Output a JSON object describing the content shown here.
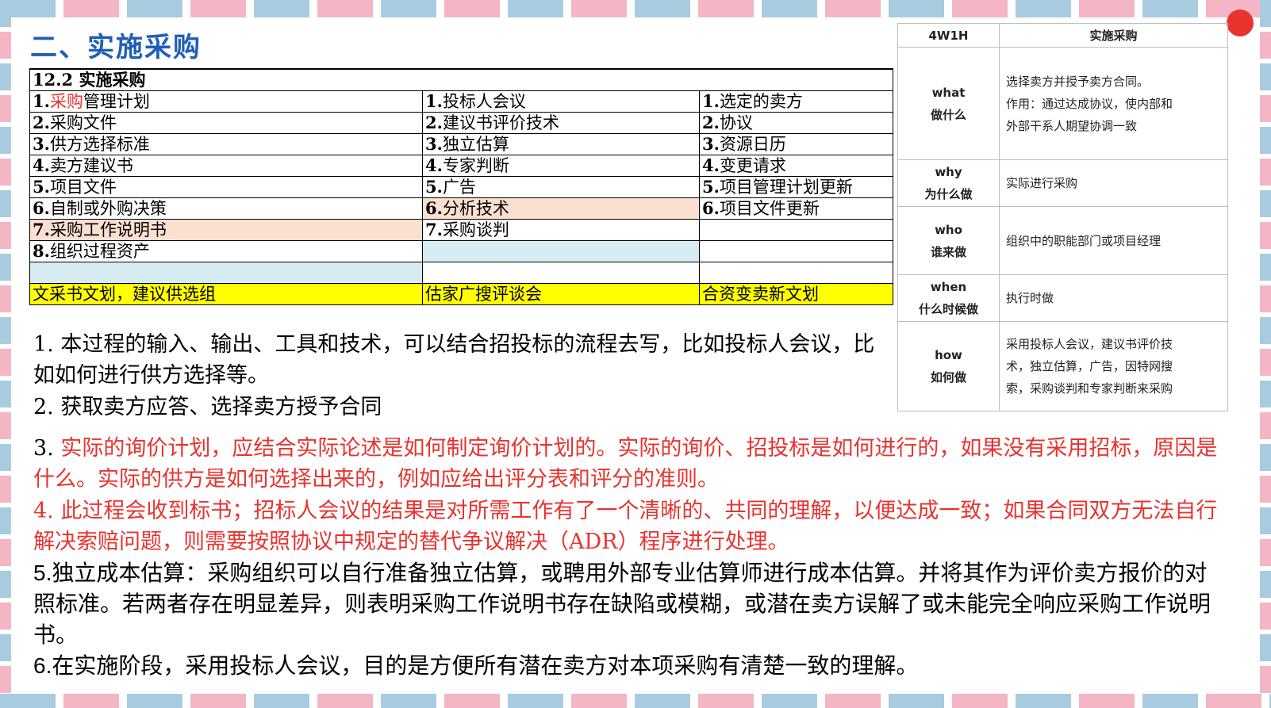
{
  "title": "二、实施采购",
  "process_table": {
    "header": "12.2 实施采购",
    "rows": [
      [
        {
          "n": "1.",
          "t": "采购管理计划",
          "red_prefix": "采购",
          "rest": "管理计划"
        },
        {
          "n": "1.",
          "t": "投标人会议"
        },
        {
          "n": "1.",
          "t": "选定的卖方"
        }
      ],
      [
        {
          "n": "2.",
          "t": "采购文件"
        },
        {
          "n": "2.",
          "t": "建议书评价技术"
        },
        {
          "n": "2.",
          "t": "协议"
        }
      ],
      [
        {
          "n": "3.",
          "t": "供方选择标准"
        },
        {
          "n": "3.",
          "t": "独立估算"
        },
        {
          "n": "3.",
          "t": "资源日历"
        }
      ],
      [
        {
          "n": "4.",
          "t": "卖方建议书"
        },
        {
          "n": "4.",
          "t": "专家判断"
        },
        {
          "n": "4.",
          "t": "变更请求"
        }
      ],
      [
        {
          "n": "5.",
          "t": "项目文件"
        },
        {
          "n": "5.",
          "t": "广告"
        },
        {
          "n": "5.",
          "t": "项目管理计划更新"
        }
      ],
      [
        {
          "n": "6.",
          "t": "自制或外购决策"
        },
        {
          "n": "6.",
          "t": "分析技术"
        },
        {
          "n": "6.",
          "t": "项目文件更新"
        }
      ],
      [
        {
          "n": "7.",
          "t": "采购工作说明书"
        },
        {
          "n": "7.",
          "t": "采购谈判"
        },
        {
          "n": "",
          "t": ""
        }
      ],
      [
        {
          "n": "8.",
          "t": "组织过程资产"
        },
        {
          "n": "",
          "t": ""
        },
        {
          "n": "",
          "t": ""
        }
      ],
      [
        {
          "n": "",
          "t": ""
        },
        {
          "n": "",
          "t": ""
        },
        {
          "n": "",
          "t": ""
        }
      ]
    ],
    "mnemonics": [
      "文采书文划，建议供选组",
      "估家广搜评谈会",
      "合资变卖新文划"
    ]
  },
  "w4h1": {
    "headers": [
      "4W1H",
      "实施采购"
    ],
    "rows": [
      {
        "en": "what",
        "zh": "做什么",
        "lines": [
          "选择卖方并授予卖方合同。",
          "作用：通过达成协议，使内部和",
          "外部干系人期望协调一致"
        ]
      },
      {
        "en": "why",
        "zh": "为什么做",
        "lines": [
          "实际进行采购"
        ]
      },
      {
        "en": "who",
        "zh": "谁来做",
        "lines": [
          "组织中的职能部门或项目经理"
        ]
      },
      {
        "en": "when",
        "zh": "什么时候做",
        "lines": [
          "执行时做"
        ]
      },
      {
        "en": "how",
        "zh": "如何做",
        "lines": [
          "采用投标人会议，建议书评价技",
          "术，独立估算，广告，因特网搜",
          "索，采购谈判和专家判断来采购"
        ]
      }
    ]
  },
  "notes": {
    "p1": "1. 本过程的输入、输出、工具和技术，可以结合招投标的流程去写，比如投标人会议，比如如何进行供方选择等。",
    "p2": "2. 获取卖方应答、选择卖方授予合同",
    "p3_num": "3. ",
    "p3": "实际的询价计划，应结合实际论述是如何制定询价计划的。实际的询价、招投标是如何进行的，如果没有采用招标，原因是什么。实际的供方是如何选择出来的，例如应给出评分表和评分的准则。",
    "p4": "4. 此过程会收到标书；招标人会议的结果是对所需工作有了一个清晰的、共同的理解，以便达成一致；如果合同双方无法自行解决索赔问题，则需要按照协议中规定的替代争议解决（ADR）程序进行处理。",
    "p5": "5.独立成本估算：采购组织可以自行准备独立估算，或聘用外部专业估算师进行成本估算。并将其作为评价卖方报价的对照标准。若两者存在明显差异，则表明采购工作说明书存在缺陷或模糊，或潜在卖方误解了或未能完全响应采购工作说明书。",
    "p6": "6.在实施阶段，采用投标人会议，目的是方便所有潜在卖方对本项采购有清楚一致的理解。"
  },
  "colors": {
    "title_blue": "#1f5fb8",
    "red": "#e8332f",
    "yellow": "#ffff00",
    "peach": "#fbe0d1",
    "light_blue": "#d7ebf2"
  }
}
